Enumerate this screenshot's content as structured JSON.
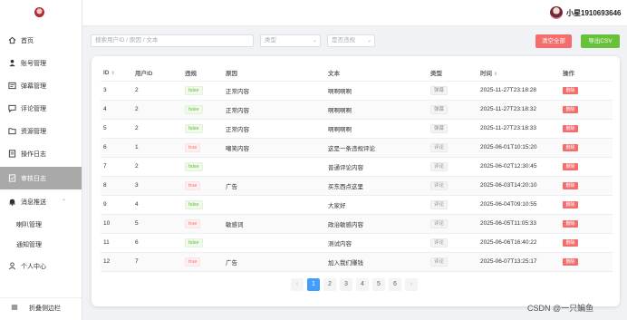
{
  "sidebar": {
    "items": [
      {
        "label": "首页",
        "icon": "home-icon"
      },
      {
        "label": "账号管理",
        "icon": "user-icon"
      },
      {
        "label": "弹幕管理",
        "icon": "barrage-icon"
      },
      {
        "label": "评论管理",
        "icon": "comment-icon"
      },
      {
        "label": "资源管理",
        "icon": "folder-icon"
      },
      {
        "label": "操作日志",
        "icon": "log-icon"
      },
      {
        "label": "审核日志",
        "icon": "audit-icon"
      },
      {
        "label": "消息推送",
        "icon": "bell-icon"
      }
    ],
    "sub_items": [
      "喇叭管理",
      "通知管理"
    ],
    "personal": "个人中心",
    "collapse": "折叠侧边栏"
  },
  "header": {
    "username": "小星1910693646"
  },
  "toolbar": {
    "search_placeholder": "搜索用户ID / 原因 / 文本",
    "type_placeholder": "类型",
    "violation_placeholder": "是否违规",
    "clear_label": "清空全部",
    "export_label": "导出CSV"
  },
  "table": {
    "headers": [
      "ID",
      "用户ID",
      "违规",
      "原因",
      "文本",
      "类型",
      "时间",
      "操作"
    ],
    "delete_label": "删除",
    "rows": [
      {
        "id": "3",
        "uid": "2",
        "violation": "false",
        "reason": "正常内容",
        "text": "啊啊啊啊",
        "type": "弹幕",
        "time": "2025-11-27T23:18:28"
      },
      {
        "id": "4",
        "uid": "2",
        "violation": "false",
        "reason": "正常内容",
        "text": "啊啊啊啊",
        "type": "弹幕",
        "time": "2025-11-27T23:18:32"
      },
      {
        "id": "5",
        "uid": "2",
        "violation": "false",
        "reason": "正常内容",
        "text": "啊啊啊啊",
        "type": "弹幕",
        "time": "2025-11-27T23:18:33"
      },
      {
        "id": "6",
        "uid": "1",
        "violation": "true",
        "reason": "嘲笑内容",
        "text": "这是一条违规评论",
        "type": "评论",
        "time": "2025-06-01T10:15:20"
      },
      {
        "id": "7",
        "uid": "2",
        "violation": "false",
        "reason": "",
        "text": "普通评论内容",
        "type": "评论",
        "time": "2025-06-02T12:30:45"
      },
      {
        "id": "8",
        "uid": "3",
        "violation": "true",
        "reason": "广告",
        "text": "买东西点这里",
        "type": "评论",
        "time": "2025-06-03T14:20:10"
      },
      {
        "id": "9",
        "uid": "4",
        "violation": "false",
        "reason": "",
        "text": "大家好",
        "type": "评论",
        "time": "2025-06-04T09:10:55"
      },
      {
        "id": "10",
        "uid": "5",
        "violation": "true",
        "reason": "敏感词",
        "text": "政治敏感内容",
        "type": "评论",
        "time": "2025-06-05T11:05:33"
      },
      {
        "id": "11",
        "uid": "6",
        "violation": "false",
        "reason": "",
        "text": "测试内容",
        "type": "评论",
        "time": "2025-06-06T16:40:22"
      },
      {
        "id": "12",
        "uid": "7",
        "violation": "true",
        "reason": "广告",
        "text": "加入我们赚钱",
        "type": "评论",
        "time": "2025-06-07T13:25:17"
      }
    ]
  },
  "pagination": {
    "pages": [
      "1",
      "2",
      "3",
      "4",
      "5",
      "6"
    ],
    "current": "1",
    "prev": "‹",
    "next": "›"
  },
  "watermark": "CSDN @一只鳊鱼",
  "colors": {
    "active_nav": "#a9a9a9",
    "danger": "#f56c6c",
    "success": "#67c23a",
    "primary": "#409eff"
  }
}
